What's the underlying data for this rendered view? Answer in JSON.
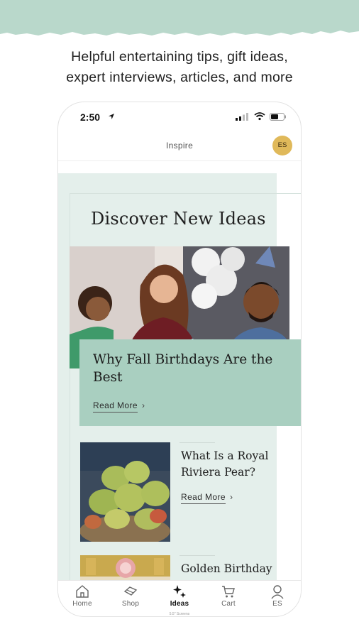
{
  "banner": {
    "line1": "Helpful entertaining tips, gift ideas,",
    "line2": "expert interviews, articles, and more"
  },
  "status_bar": {
    "time": "2:50"
  },
  "header": {
    "title": "Inspire",
    "avatar_initials": "ES"
  },
  "section": {
    "title": "Discover New Ideas"
  },
  "featured": {
    "title": "Why Fall Birthdays Are the Best",
    "read_more": "Read More"
  },
  "articles": [
    {
      "title": "What Is a Royal Riviera Pear?",
      "read_more": "Read More"
    },
    {
      "title": "Golden Birthday"
    }
  ],
  "tabs": [
    {
      "label": "Home",
      "icon": "home-icon"
    },
    {
      "label": "Shop",
      "icon": "gift-icon"
    },
    {
      "label": "Ideas",
      "icon": "sparkle-icon",
      "active": true
    },
    {
      "label": "Cart",
      "icon": "cart-icon"
    },
    {
      "label": "ES",
      "icon": "person-icon"
    }
  ],
  "screen_note": "5.5\" Screens",
  "colors": {
    "mint_band": "#b9d8cb",
    "mint_bg": "#e4efeb",
    "card": "#a9cfc0",
    "avatar": "#e0b95a"
  }
}
